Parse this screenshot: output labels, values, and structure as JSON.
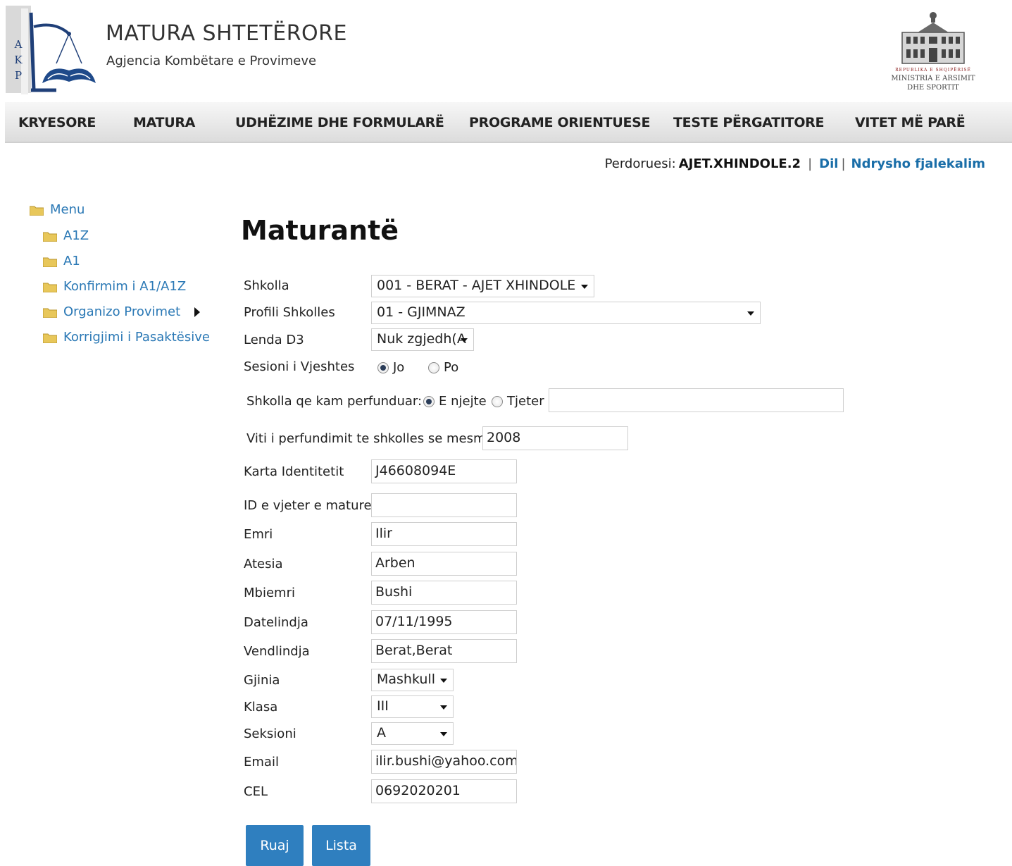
{
  "header": {
    "logo_letters": [
      "A",
      "K",
      "P"
    ],
    "title": "MATURA SHTETËRORE",
    "subtitle": "Agjencia Kombëtare e Provimeve",
    "ministry_line1": "REPUBLIKA E SHQIPËRISË",
    "ministry_line2": "MINISTRIA E ARSIMIT",
    "ministry_line3": "DHE SPORTIT"
  },
  "nav": [
    "KRYESORE",
    "MATURA",
    "UDHËZIME DHE FORMULARË",
    "PROGRAME ORIENTUESE",
    "TESTE PËRGATITORE",
    "VITET MË PARË"
  ],
  "userbar": {
    "label": "Perdoruesi:",
    "username": "AJET.XHINDOLE.2",
    "separator": "|",
    "logout": "Dil",
    "logout_sep": "|",
    "change_password": "Ndrysho fjalekalim"
  },
  "sidebar": {
    "root": "Menu",
    "items": [
      "A1Z",
      "A1",
      "Konfirmim i A1/A1Z",
      "Organizo Provimet",
      "Korrigjimi i Pasaktësive"
    ]
  },
  "form": {
    "title": "Maturantë",
    "school": {
      "label": "Shkolla",
      "value": "001 - BERAT - AJET XHINDOLE"
    },
    "profile": {
      "label": "Profili Shkolles",
      "value": "01 - GJIMNAZ"
    },
    "subject": {
      "label": "Lenda D3",
      "value": "Nuk zgjedh(A"
    },
    "autumn": {
      "label": "Sesioni i Vjeshtes",
      "opt_no": "Jo",
      "opt_yes": "Po",
      "selected": "Jo"
    },
    "finished_school": {
      "label": "Shkolla qe kam perfunduar:",
      "opt_same": "E njejte",
      "opt_other": "Tjeter",
      "selected": "E njejte",
      "other_value": ""
    },
    "grad_year": {
      "label": "Viti i perfundimit te shkolles se mesme:",
      "value": "2008"
    },
    "id_card": {
      "label": "Karta Identitetit",
      "value": "J46608094E"
    },
    "old_id": {
      "label": "ID e vjeter e matures",
      "value": ""
    },
    "first_name": {
      "label": "Emri",
      "value": "Ilir"
    },
    "father_name": {
      "label": "Atesia",
      "value": "Arben"
    },
    "last_name": {
      "label": "Mbiemri",
      "value": "Bushi"
    },
    "birthdate": {
      "label": "Datelindja",
      "value": "07/11/1995"
    },
    "birthplace": {
      "label": "Vendlindja",
      "value": "Berat,Berat"
    },
    "gender": {
      "label": "Gjinia",
      "value": "Mashkull"
    },
    "class": {
      "label": "Klasa",
      "value": "III"
    },
    "section": {
      "label": "Seksioni",
      "value": "A"
    },
    "email": {
      "label": "Email",
      "value": "ilir.bushi@yahoo.com"
    },
    "phone": {
      "label": "CEL",
      "value": "0692020201"
    }
  },
  "buttons": {
    "save": "Ruaj",
    "list": "Lista"
  },
  "colors": {
    "link": "#2a78b5",
    "button": "#2f7fbf",
    "folder": "#e8c75a"
  }
}
